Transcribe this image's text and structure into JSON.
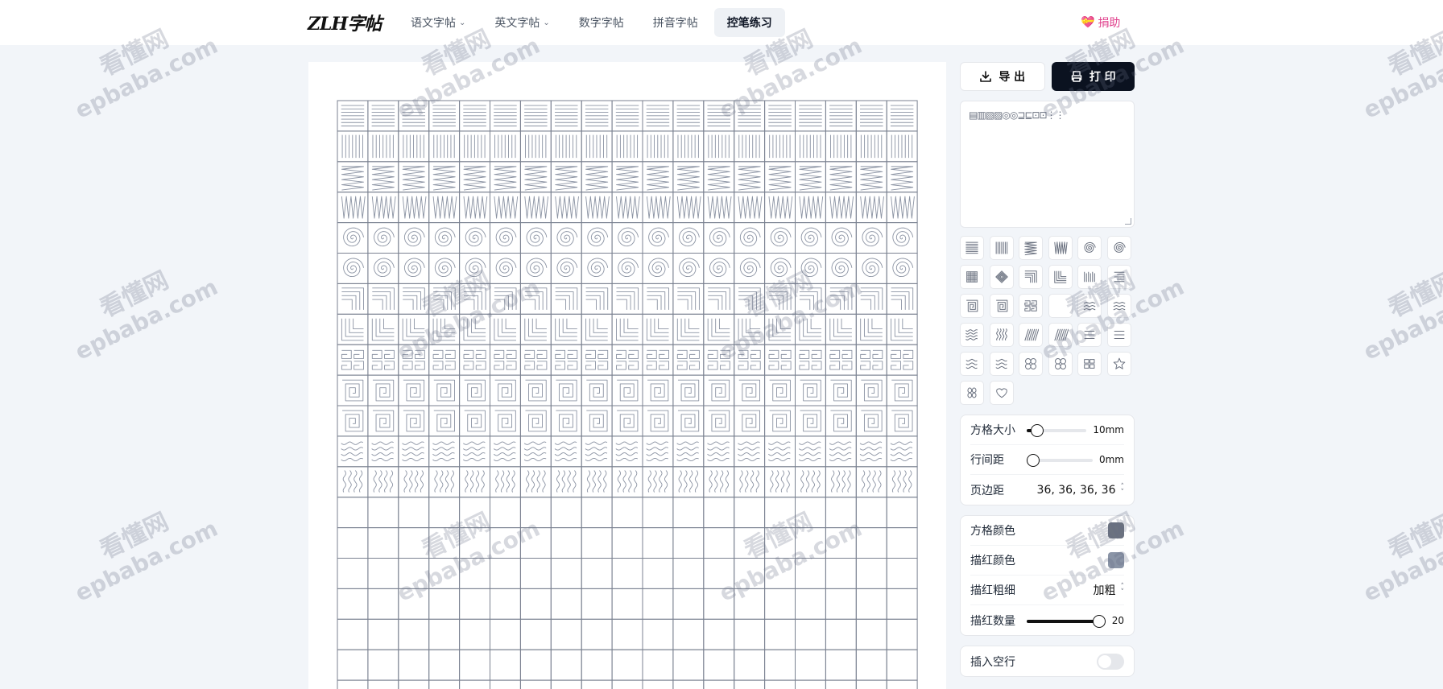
{
  "logo": {
    "text": "ZLH字帖"
  },
  "nav": [
    {
      "label": "语文字帖",
      "dropdown": true,
      "active": false
    },
    {
      "label": "英文字帖",
      "dropdown": true,
      "active": false
    },
    {
      "label": "数字字帖",
      "dropdown": false,
      "active": false
    },
    {
      "label": "拼音字帖",
      "dropdown": false,
      "active": false
    },
    {
      "label": "控笔练习",
      "dropdown": false,
      "active": true
    }
  ],
  "donate": {
    "label": "捐助",
    "icon": "heart-gift-icon"
  },
  "toolbar": {
    "export_label": "导 出",
    "print_label": "打 印"
  },
  "text_input": {
    "value": "▤▥▧▨◎◎⊒⊑⊡⊡⋮⋮"
  },
  "pattern_icons": [
    "horizontal-lines",
    "vertical-lines",
    "zigzag-horizontal",
    "zigzag-vertical",
    "spiral",
    "spiral-alt",
    "grid-dense",
    "diamond",
    "corner-top-right",
    "corner-bottom-left",
    "vertical-bars",
    "horizontal-steps",
    "square-spiral",
    "square-spiral-alt",
    "meander",
    "meander-alt",
    "chevron-waves",
    "chevron-waves-alt",
    "waves-horizontal",
    "waves-vertical",
    "diagonal-lines",
    "diagonal-lines-alt",
    "dotted-steps",
    "dotted-steps-alt",
    "double-waves",
    "slanted-waves",
    "circle-waves",
    "circles",
    "squares",
    "star",
    "circles-pair",
    "heart"
  ],
  "settings": {
    "grid_size": {
      "label": "方格大小",
      "value": "10mm",
      "fraction": 0.08
    },
    "line_spacing": {
      "label": "行间距",
      "value": "0mm",
      "fraction": 0.0
    },
    "page_margin": {
      "label": "页边距",
      "value": "36, 36, 36, 36"
    }
  },
  "colors": {
    "grid_color": {
      "label": "方格颜色",
      "hex": "#6b7280"
    },
    "trace_color": {
      "label": "描红颜色",
      "hex": "#8a94a6"
    },
    "trace_weight": {
      "label": "描红粗细",
      "value": "加粗"
    },
    "trace_count": {
      "label": "描红数量",
      "value": "20",
      "fraction": 1.0
    }
  },
  "insert_blank": {
    "label": "插入空行",
    "on": false
  },
  "watermark": {
    "line1": "看懂网",
    "line2": "epbaba.com"
  },
  "sheet": {
    "cols": 19,
    "rows": 20,
    "pattern_rows": [
      "horizontal-lines",
      "vertical-lines",
      "zigzag-horizontal",
      "zigzag-vertical",
      "spiral",
      "spiral",
      "corner-top-right",
      "corner-bottom-left",
      "meander",
      "square-spiral",
      "square-spiral",
      "waves-horizontal",
      "waves-vertical"
    ],
    "grid_color": "#7b8291",
    "stroke_color": "#8b93a3"
  }
}
